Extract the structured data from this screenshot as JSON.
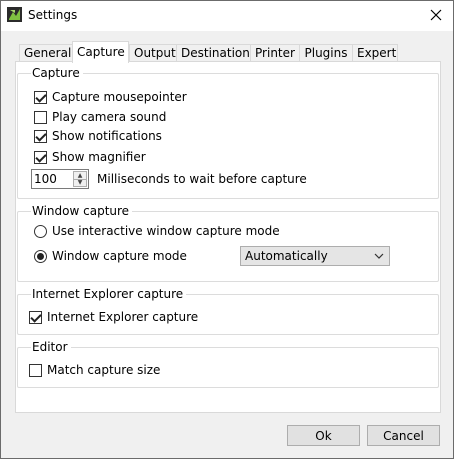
{
  "window": {
    "title": "Settings"
  },
  "icons": {
    "app": "greenshot-app-icon",
    "close": "close-icon",
    "chevron": "chevron-down-icon"
  },
  "tabs": [
    "General",
    "Capture",
    "Output",
    "Destination",
    "Printer",
    "Plugins",
    "Expert"
  ],
  "active_tab": "Capture",
  "capture_group": {
    "title": "Capture",
    "options": [
      {
        "label": "Capture mousepointer",
        "checked": true
      },
      {
        "label": "Play camera sound",
        "checked": false
      },
      {
        "label": "Show notifications",
        "checked": true
      },
      {
        "label": "Show magnifier",
        "checked": true
      }
    ],
    "wait": {
      "value": "100",
      "label": "Milliseconds to wait before capture"
    }
  },
  "window_capture_group": {
    "title": "Window capture",
    "interactive_label": "Use interactive window capture mode",
    "mode_label": "Window capture mode",
    "selected_mode": "mode",
    "mode_value": "Automatically"
  },
  "ie_group": {
    "title": "Internet Explorer capture",
    "option": {
      "label": "Internet Explorer capture",
      "checked": true
    }
  },
  "editor_group": {
    "title": "Editor",
    "option": {
      "label": "Match capture size",
      "checked": false
    }
  },
  "footer": {
    "ok_label": "Ok",
    "cancel_label": "Cancel"
  }
}
